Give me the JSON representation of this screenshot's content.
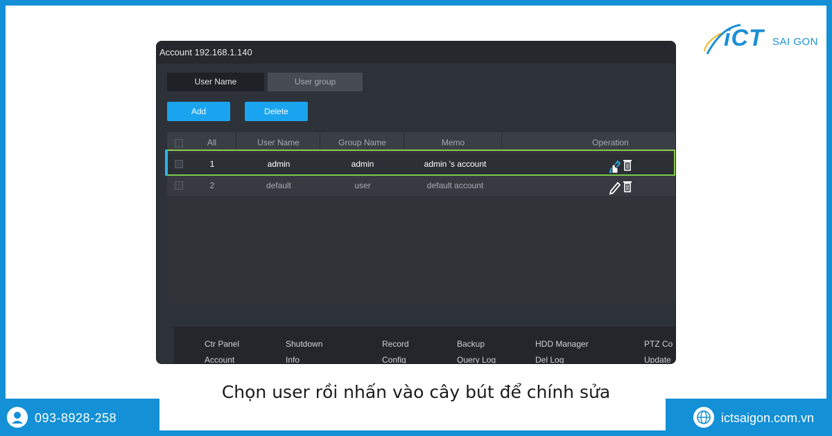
{
  "brand": {
    "logo_main": "iCT",
    "logo_sub": "SAI GON"
  },
  "window": {
    "title": "Account 192.168.1.140"
  },
  "tabs": [
    {
      "label": "User Name"
    },
    {
      "label": "User group"
    }
  ],
  "buttons": {
    "add": "Add",
    "delete": "Delete"
  },
  "table": {
    "headers": [
      "All",
      "User Name",
      "Group Name",
      "Memo",
      "Operation"
    ],
    "rows": [
      {
        "index": "1",
        "user": "admin",
        "group": "admin",
        "memo": "admin 's account"
      },
      {
        "index": "2",
        "user": "default",
        "group": "user",
        "memo": "default account"
      }
    ]
  },
  "footer_menu": {
    "row1": [
      "Ctr Panel",
      "Shutdown",
      "Record",
      "Backup",
      "HDD Manager",
      "PTZ Co"
    ],
    "row2": [
      "Account",
      "Info",
      "Config",
      "Query Log",
      "Del Log",
      "Update"
    ]
  },
  "caption": "Chọn user rồi nhấn vào cây bút để chính sửa",
  "contact": {
    "phone": "093-8928-258",
    "website": "ictsaigon.com.vn"
  },
  "colors": {
    "brand_blue": "#1390d6",
    "button_blue": "#1aa3ee",
    "highlight_green": "#8bc94a"
  }
}
